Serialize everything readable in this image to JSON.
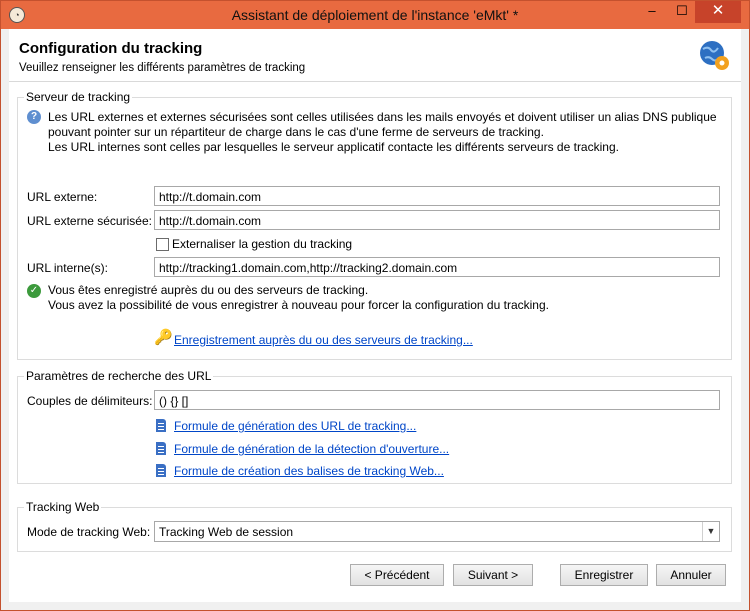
{
  "window": {
    "title": "Assistant de déploiement de l'instance 'eMkt' *",
    "min_glyph": "–",
    "max_glyph": "☐",
    "close_glyph": "✕"
  },
  "header": {
    "title": "Configuration du tracking",
    "subtitle": "Veuillez renseigner les différents paramètres de tracking",
    "icon": "globe-gear-icon"
  },
  "tracking_server": {
    "group_title": "Serveur de tracking",
    "info_lines": [
      "Les URL externes et externes sécurisées sont celles utilisées dans les mails envoyés et doivent utiliser un alias DNS publique",
      "pouvant pointer sur un répartiteur de charge dans le cas d'une ferme de serveurs de tracking.",
      "Les URL internes sont celles par lesquelles le serveur applicatif contacte les différents serveurs de tracking."
    ],
    "external_url_label": "URL externe:",
    "external_url_value": "http://t.domain.com",
    "secure_url_label": "URL externe sécurisée:",
    "secure_url_value": "http://t.domain.com",
    "outsource_label": "Externaliser la gestion du tracking",
    "internal_url_label": "URL interne(s):",
    "internal_url_value": "http://tracking1.domain.com,http://tracking2.domain.com",
    "status_lines": [
      "Vous êtes enregistré auprès du ou des serveurs de tracking.",
      "Vous avez la possibilité de vous enregistrer à nouveau pour forcer la configuration du tracking."
    ],
    "register_link": "Enregistrement auprès du ou des serveurs de tracking..."
  },
  "url_search": {
    "group_title": "Paramètres de recherche des URL",
    "delimiters_label": "Couples de délimiteurs:",
    "delimiters_value": "() {} []",
    "links": [
      "Formule de génération des URL de tracking...",
      "Formule de génération de la détection d'ouverture...",
      "Formule de création des balises de tracking Web..."
    ]
  },
  "web_tracking": {
    "group_title": "Tracking Web",
    "mode_label": "Mode de tracking Web:",
    "mode_value": "Tracking Web de session"
  },
  "footer": {
    "previous": "< Précédent",
    "next": "Suivant >",
    "save": "Enregistrer",
    "cancel": "Annuler"
  },
  "colors": {
    "titlebar": "#e86a40",
    "close_button": "#c7432a",
    "link": "#0046c8"
  }
}
